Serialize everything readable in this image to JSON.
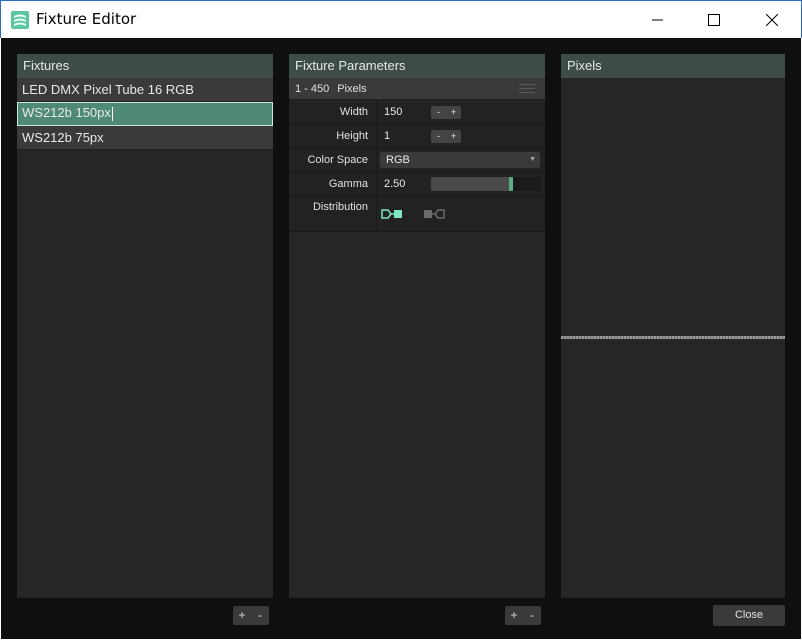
{
  "window": {
    "title": "Fixture Editor",
    "icons": {
      "app": "app-logo-icon",
      "minimize": "minimize-icon",
      "maximize": "maximize-icon",
      "close": "close-icon"
    }
  },
  "fixtures": {
    "header": "Fixtures",
    "items": [
      {
        "label": "LED DMX Pixel Tube 16 RGB",
        "selected": false
      },
      {
        "label": "WS212b 150px",
        "selected": true
      },
      {
        "label": "WS212b 75px",
        "selected": false
      }
    ],
    "add_label": "+",
    "remove_label": "-"
  },
  "parameters": {
    "header": "Fixture Parameters",
    "range": "1 - 450",
    "mode": "Pixels",
    "width": {
      "label": "Width",
      "value": "150",
      "dec": "-",
      "inc": "+"
    },
    "height": {
      "label": "Height",
      "value": "1",
      "dec": "-",
      "inc": "+"
    },
    "color_space": {
      "label": "Color Space",
      "value": "RGB"
    },
    "gamma": {
      "label": "Gamma",
      "value": "2.50",
      "level": 0.73
    },
    "distribution": {
      "label": "Distribution",
      "options": [
        "distribution-forward-icon",
        "distribution-reverse-icon"
      ],
      "active": 0
    },
    "add_label": "+",
    "remove_label": "-"
  },
  "pixels": {
    "header": "Pixels"
  },
  "footer": {
    "close_label": "Close"
  },
  "colors": {
    "accent": "#5aaa86",
    "active_icon": "#7fe8c0",
    "header_bg": "#3d4c48",
    "selected_bg": "#4f8a76"
  }
}
